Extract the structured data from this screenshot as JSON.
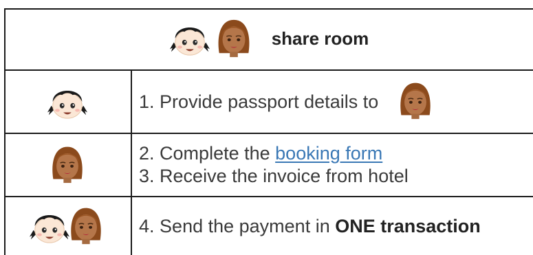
{
  "header": {
    "title": "share room"
  },
  "steps": [
    {
      "number": "1.",
      "text": "Provide passport details to"
    },
    {
      "number": "2.",
      "text": "Complete the",
      "link": "booking form"
    },
    {
      "number": "3.",
      "text": "Receive the invoice from hotel"
    },
    {
      "number": "4.",
      "text": "Send the payment in",
      "bold": "ONE transaction"
    }
  ],
  "icons": {
    "person_a": "girl-pigtails-emoji-icon",
    "person_b": "woman-brown-hair-emoji-icon"
  },
  "colors": {
    "link": "#3a78b5",
    "border": "#1a1a1a",
    "text": "#3a3a3a"
  }
}
